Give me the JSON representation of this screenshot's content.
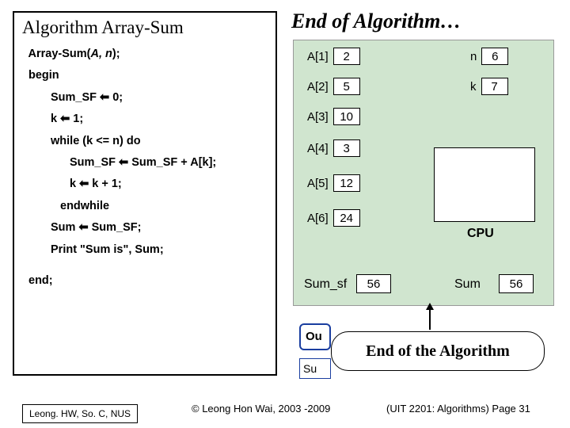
{
  "title_left": "Algorithm Array-Sum",
  "title_right": "End of Algorithm…",
  "code": {
    "l1a": "Array-Sum(",
    "l1b": "A, n",
    "l1c": ");",
    "l2": "begin",
    "l3a": "Sum_SF ",
    "l3b": " 0;",
    "l4a": "k ",
    "l4b": " 1;",
    "l5": "while (k <= n) do",
    "l6a": "Sum_SF ",
    "l6b": " Sum_SF + A[k];",
    "l7a": "k ",
    "l7b": " k + 1;",
    "l8": "endwhile",
    "l9a": "Sum ",
    "l9b": " Sum_SF;",
    "l10": "Print \"Sum is\", Sum;",
    "l11": "end;"
  },
  "arrow": "⬅",
  "mem": {
    "A": [
      {
        "k": "A[1]",
        "v": "2"
      },
      {
        "k": "A[2]",
        "v": "5"
      },
      {
        "k": "A[3]",
        "v": "10"
      },
      {
        "k": "A[4]",
        "v": "3"
      },
      {
        "k": "A[5]",
        "v": "12"
      },
      {
        "k": "A[6]",
        "v": "24"
      }
    ],
    "n_label": "n",
    "n_val": "6",
    "k_label": "k",
    "k_val": "7",
    "cpu": "CPU",
    "sumsf_label": "Sum_sf",
    "sumsf_val": "56",
    "sum_label": "Sum",
    "sum_val": "56"
  },
  "out": "Ou",
  "su": "Su",
  "end_pill": "End of the Algorithm",
  "footer": {
    "left": "Leong. HW, So. C, NUS",
    "center": "© Leong Hon Wai, 2003 -2009",
    "right": "(UIT 2201: Algorithms) Page 31"
  }
}
